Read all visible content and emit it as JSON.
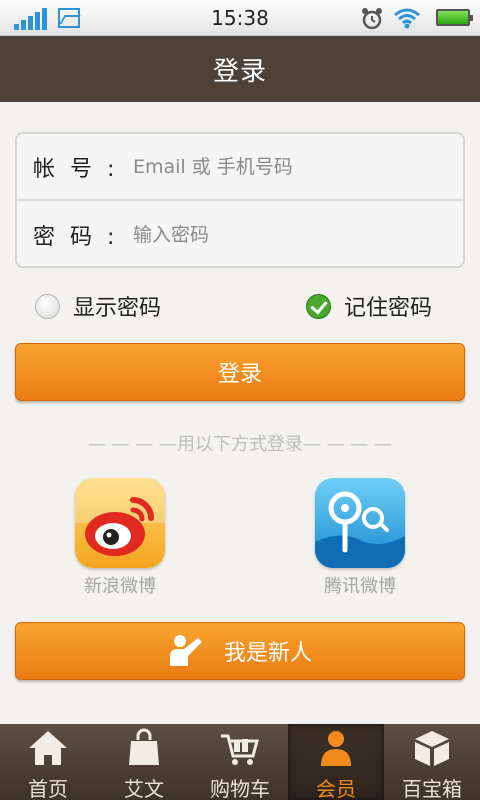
{
  "status_bar": {
    "time": "15:38"
  },
  "header": {
    "title": "登录"
  },
  "form": {
    "account_label": "帐 号 :",
    "account_placeholder": "Email 或 手机号码",
    "password_label": "密 码 :",
    "password_placeholder": "输入密码"
  },
  "options": {
    "show_password": "显示密码",
    "remember_password": "记住密码"
  },
  "login_button": "登录",
  "divider_text": "— — — —用以下方式登录— — — —",
  "social": {
    "weibo": "新浪微博",
    "tencent": "腾讯微博"
  },
  "newbie_button": "我是新人",
  "tabs": [
    {
      "label": "首页",
      "icon": "home-icon"
    },
    {
      "label": "艾文",
      "icon": "shopping-bag-icon"
    },
    {
      "label": "购物车",
      "icon": "cart-icon"
    },
    {
      "label": "会员",
      "icon": "member-icon",
      "active": true
    },
    {
      "label": "百宝箱",
      "icon": "box-icon"
    }
  ],
  "colors": {
    "accent": "#f08a1c",
    "title_bar": "#4e4238",
    "status_blue": "#2b93d6",
    "check_green": "#4aa82f"
  }
}
